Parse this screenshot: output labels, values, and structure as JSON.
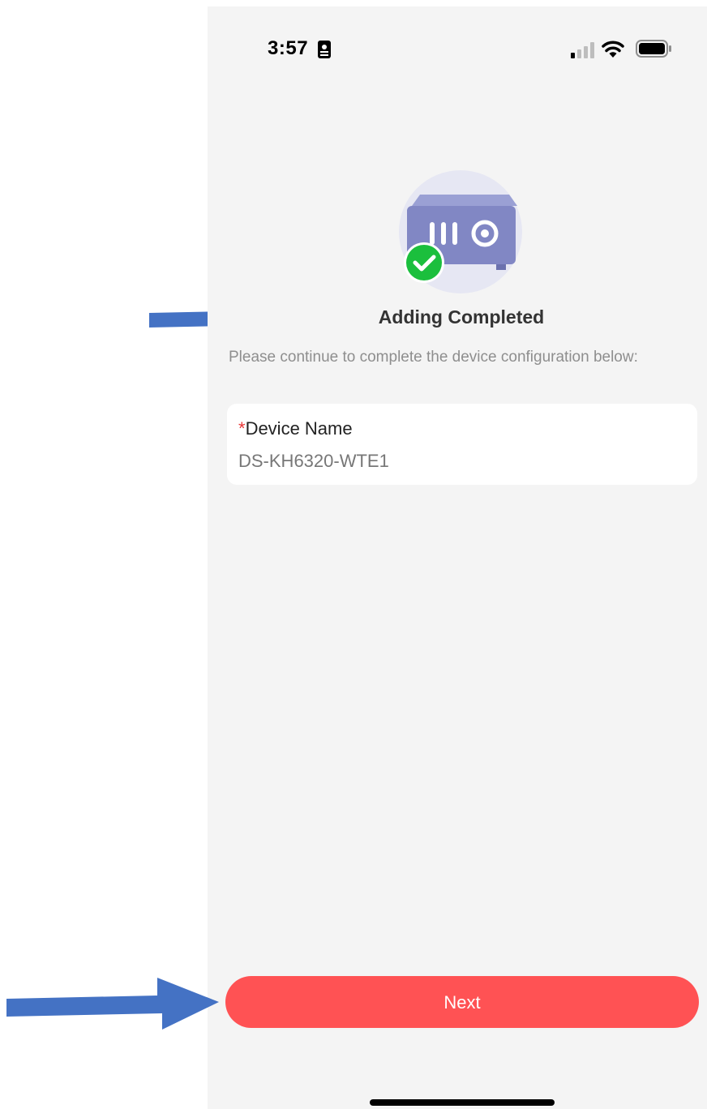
{
  "status_bar": {
    "time": "3:57",
    "icons": [
      "id-badge-icon",
      "cellular-signal-icon",
      "wifi-icon",
      "battery-icon"
    ]
  },
  "illustration": {
    "icon": "device-added-success-icon",
    "colors": {
      "circle": "#e6e7f3",
      "device": "#8187c4",
      "check": "#1bbf3d"
    }
  },
  "main": {
    "title": "Adding Completed",
    "subtitle": "Please continue to complete the device configuration below:"
  },
  "device_name_field": {
    "required_mark": "*",
    "label": "Device Name",
    "value": "DS-KH6320-WTE1"
  },
  "footer": {
    "next_label": "Next"
  },
  "colors": {
    "background": "#f4f4f4",
    "accent": "#ff5254",
    "annotation_arrow": "#4472c4"
  },
  "annotations": [
    "arrow-pointing-to-title",
    "arrow-pointing-to-next-button"
  ]
}
